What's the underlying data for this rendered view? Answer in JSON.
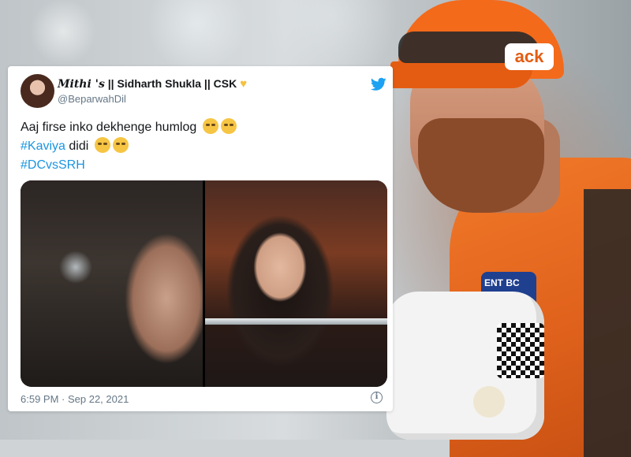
{
  "tweet": {
    "display_name_styled": "𝑴𝒊𝒕𝒉𝒊 '𝒔",
    "display_name_rest": " || Sidharth Shukla || CSK",
    "handle": "@BeparwahDil",
    "body_line1": "Aaj firse inko dekhenge humlog",
    "hashtag1": "#Kaviya",
    "body_line2_rest": " didi",
    "hashtag2": "#DCvsSRH",
    "timestamp": "6:59 PM · Sep 22, 2021",
    "info_glyph": "i"
  },
  "background": {
    "cap_logo_text": "ack",
    "sponsor_text": "ENT BC"
  },
  "colors": {
    "twitter_blue": "#1da1f2",
    "hashtag": "#1b95e0",
    "jersey_orange": "#f27a2a"
  },
  "icons": [
    "twitter-bird-icon",
    "heart-icon",
    "info-icon",
    "emoji-icon"
  ]
}
